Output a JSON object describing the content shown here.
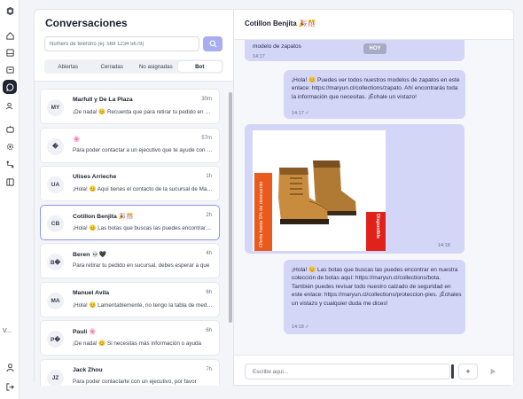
{
  "nav": {
    "icons": [
      "logo-icon",
      "home-icon",
      "inbox-icon",
      "archive-icon",
      "chat-icon",
      "contacts-icon",
      "bot-icon",
      "settings-icon",
      "flow-icon",
      "templates-icon",
      "user-icon",
      "logout-icon"
    ],
    "version": "V...",
    "active": "chat-icon"
  },
  "conversations": {
    "title": "Conversaciones",
    "search_placeholder": "Número de teléfono (ej: 569 1234 5678)",
    "tabs": [
      {
        "label": "Abiertas",
        "active": false
      },
      {
        "label": "Cerradas",
        "active": false
      },
      {
        "label": "No asignadas",
        "active": false
      },
      {
        "label": "Bot",
        "active": true
      }
    ],
    "items": [
      {
        "initials": "MY",
        "name": "Marfull y De La Plaza",
        "time": "30m",
        "preview": "¡De nada! 😊 Recuerda que para retirar tu pedido en sucursal"
      },
      {
        "initials": "�",
        "name": "🌸",
        "time": "57m",
        "preview": "Para poder contactar a un ejecutivo que te ayude con tu consulta"
      },
      {
        "initials": "UA",
        "name": "Ulises Arrieche",
        "time": "1h",
        "preview": "¡Hola! 😊 Aquí tienes el contacto de la sucursal de Maipú"
      },
      {
        "initials": "CB",
        "name": "Cotillon Benjita 🎉🎊",
        "time": "2h",
        "preview": "¡Hola! 😊 Las botas que buscas las puedes encontrar en nuestra",
        "selected": true
      },
      {
        "initials": "B�",
        "name": "Beren 💀🖤",
        "time": "4h",
        "preview": "Para retirar tu pedido en sucursal, debes esperar a que"
      },
      {
        "initials": "MA",
        "name": "Manuel Avila",
        "time": "6h",
        "preview": "¡Hola! 😊 Lamentablemente, no tengo la tabla de medidas"
      },
      {
        "initials": "P�",
        "name": "Pauli 🌸",
        "time": "6h",
        "preview": "¡De nada! 😊 Si necesitas más información o ayuda"
      },
      {
        "initials": "JZ",
        "name": "Jack Zhou",
        "time": "7h",
        "preview": "Para poder contactarte con un ejecutivo, por favor"
      }
    ]
  },
  "chat": {
    "title": "Cotillon Benjita 🎉🎊",
    "day_badge": "HOY",
    "messages": [
      {
        "text": "modelo de zapatos",
        "time": "14:17",
        "side": "in"
      },
      {
        "text": "¡Hola! 😊 Puedes ver todos nuestros modelos de zapatos en este enlace: https://maryun.cl/collections/zapato. Ahí encontrarás toda la información que necesitas. ¡Échale un vistazo!",
        "time": "14:17 ✓",
        "side": "out"
      },
      {
        "text": "",
        "time": "14:18",
        "side": "in",
        "image": true,
        "image_side_text_left": "Oferta hasta 5% de descuento",
        "image_side_text_right": "Disponible"
      },
      {
        "text": "¡Hola! 😊 Las botas que buscas las puedes encontrar en nuestra colección de botas aquí: https://maryun.cl/collections/bota. También puedes revisar todo nuestro calzado de seguridad en este enlace: https://maryun.cl/collections/proteccion-pies. ¡Échales un vistazo y cualquier duda me dices!",
        "time": "14:18 ✓",
        "side": "out"
      }
    ],
    "composer_placeholder": "Escribe aquí...",
    "plus_label": "+",
    "colors": {
      "bubble": "#d4d6f7",
      "accent": "#a7adf0"
    }
  }
}
